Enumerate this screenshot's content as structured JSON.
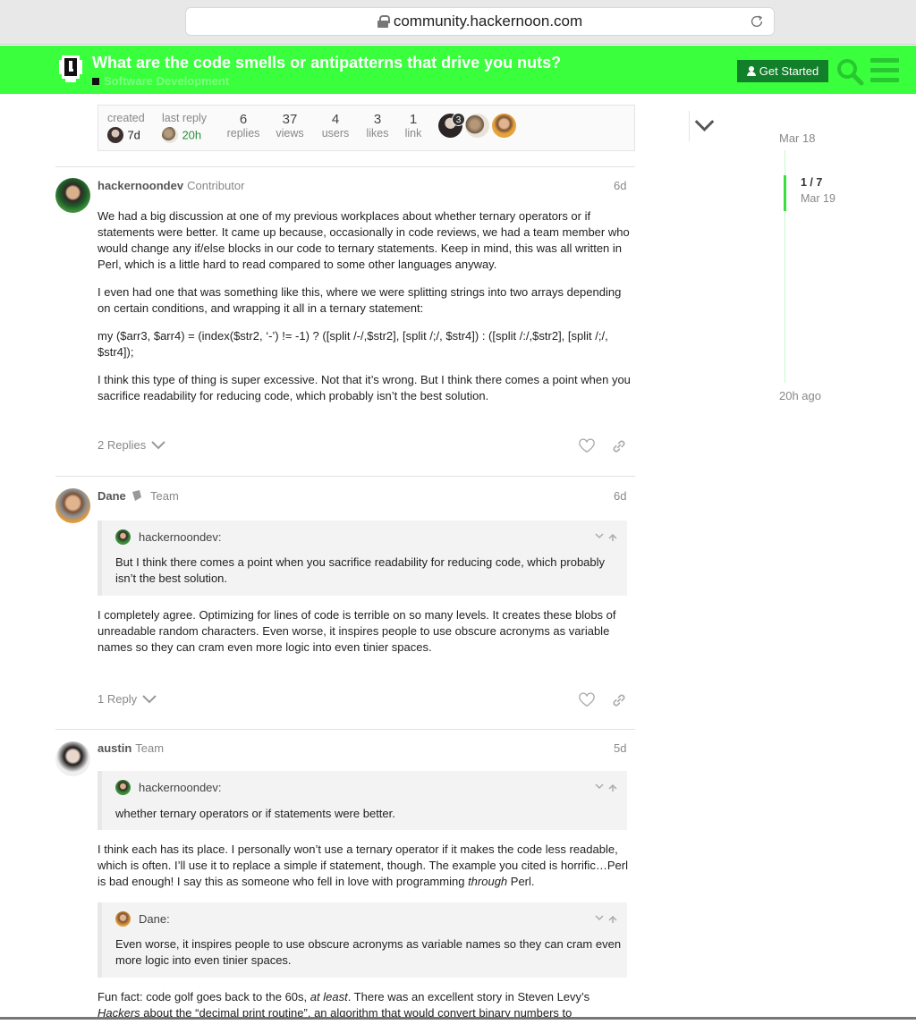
{
  "browser": {
    "url": "community.hackernoon.com"
  },
  "header": {
    "title": "What are the code smells or antipatterns that drive you nuts?",
    "category": "Software Development",
    "get_started": "Get Started",
    "accent_color": "#39ff3c"
  },
  "topic_map": {
    "created_label": "created",
    "created_value": "7d",
    "last_reply_label": "last reply",
    "last_reply_value": "20h",
    "replies_num": "6",
    "replies_label": "replies",
    "views_num": "37",
    "views_label": "views",
    "users_num": "4",
    "users_label": "users",
    "likes_num": "3",
    "likes_label": "likes",
    "link_num": "1",
    "link_label": "link",
    "avatar_badge": "3"
  },
  "posts": [
    {
      "username": "hackernoondev",
      "title": "Contributor",
      "date": "6d",
      "paragraphs": [
        "We had a big discussion at one of my previous workplaces about whether ternary operators or if statements were better. It came up because, occasionally in code reviews, we had a team member who would change any if/else blocks in our code to ternary statements. Keep in mind, this was all written in Perl, which is a little hard to read compared to some other languages anyway.",
        "I even had one that was something like this, where we were splitting strings into two arrays depending on certain conditions, and wrapping it all in a ternary statement:",
        "my ($arr3, $arr4) = (index($str2, ‘-’) != -1) ? ([split /-/,$str2], [split /;/, $str4]) : ([split /:/,$str2], [split /;/, $str4]);",
        "I think this type of thing is super excessive. Not that it’s wrong. But I think there comes a point when you sacrifice readability for reducing code, which probably isn’t the best solution."
      ],
      "replies": "2 Replies"
    },
    {
      "username": "Dane",
      "title": "Team",
      "date": "6d",
      "quote_author": "hackernoondev:",
      "quote_text": "But I think there comes a point when you sacrifice readability for reducing code, which probably isn’t the best solution.",
      "paragraphs": [
        "I completely agree. Optimizing for lines of code is terrible on so many levels. It creates these blobs of unreadable random characters. Even worse, it inspires people to use obscure acronyms as variable names so they can cram even more logic into even tinier spaces."
      ],
      "replies": "1 Reply"
    },
    {
      "username": "austin",
      "title": "Team",
      "date": "5d",
      "quote_author": "hackernoondev:",
      "quote_text": "whether ternary operators or if statements were better.",
      "p1_a": "I think each has its place. I personally won’t use a ternary operator if it makes the code less readable, which is often. I’ll use it to replace a simple if statement, though. The example you cited is horrific…Perl is bad enough! I say this as someone who fell in love with programming ",
      "p1_em": "through",
      "p1_b": " Perl.",
      "quote2_author": "Dane:",
      "quote2_text": "Even worse, it inspires people to use obscure acronyms as variable names so they can cram even more logic into even tinier spaces.",
      "p2_a": "Fun fact: code golf goes back to the 60s, ",
      "p2_em": "at least",
      "p2_b": ". There was an excellent story in Steven Levy’s ",
      "p2_em2": "Hackers",
      "p2_c": " about the “decimal print routine”, an algorithm that would convert binary numbers to"
    }
  ],
  "timeline": {
    "top_date": "Mar 18",
    "position": "1 / 7",
    "position_date": "Mar 19",
    "bottom_date": "20h ago"
  }
}
